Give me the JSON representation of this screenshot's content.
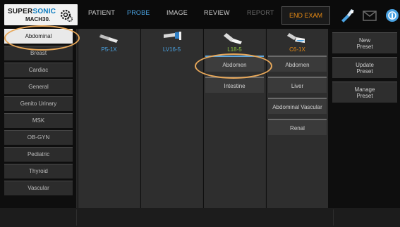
{
  "logo": {
    "brand_prefix": "SUPER",
    "brand_accent": "SONIC",
    "model": "MACH30."
  },
  "nav": {
    "patient": "PATIENT",
    "probe": "PROBE",
    "image": "IMAGE",
    "review": "REVIEW",
    "report": "REPORT",
    "end_exam": "END EXAM"
  },
  "sidebar": {
    "items": [
      {
        "label": "Abdominal",
        "selected": true
      },
      {
        "label": "Breast"
      },
      {
        "label": "Cardiac"
      },
      {
        "label": "General"
      },
      {
        "label": "Genito Urinary"
      },
      {
        "label": "MSK"
      },
      {
        "label": "OB-GYN"
      },
      {
        "label": "Pediatric"
      },
      {
        "label": "Thyroid"
      },
      {
        "label": "Vascular"
      }
    ]
  },
  "probes": [
    {
      "name": "P5-1X",
      "color": "#4aa3e2",
      "presets": []
    },
    {
      "name": "LV16-5",
      "color": "#4aa3e2",
      "presets": []
    },
    {
      "name": "L18-5",
      "color": "#8bc43f",
      "presets": [
        "Abdomen",
        "Intestine"
      ]
    },
    {
      "name": "C6-1X",
      "color": "#e88b14",
      "presets": [
        "Abdomen",
        "Liver",
        "Abdominal Vascular",
        "Renal"
      ]
    }
  ],
  "right_panel": {
    "new_preset": "New\nPreset",
    "update_preset": "Update\nPreset",
    "manage_preset": "Manage\nPreset"
  },
  "colors": {
    "accent_blue": "#4aa3e2",
    "accent_orange": "#e88b14",
    "highlight": "#e8a85a"
  }
}
